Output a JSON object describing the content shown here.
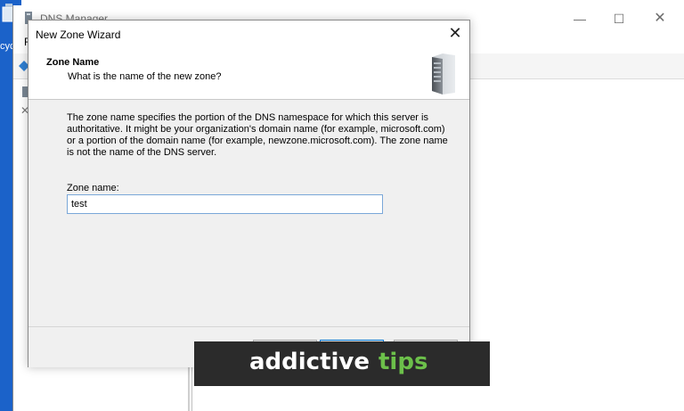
{
  "desktop": {
    "recycle_label": "cyc"
  },
  "dns_window": {
    "title": "DNS Manager",
    "menu_first_letter": "F",
    "controls": {
      "minimize": "—",
      "maximize": "☐",
      "close": "✕"
    }
  },
  "wizard": {
    "title": "New Zone Wizard",
    "close": "✕",
    "heading": "Zone Name",
    "subheading": "What is the name of the new zone?",
    "description": "The zone name specifies the portion of the DNS namespace for which this server is authoritative. It might be your organization's domain name (for example, microsoft.com) or a portion of the domain name (for example, newzone.microsoft.com). The zone name is not the name of the DNS server.",
    "zone_name_label": "Zone name:",
    "zone_name_value": "test",
    "buttons": {
      "back": "",
      "next": "",
      "cancel": ""
    }
  },
  "watermark": {
    "part1": "addictive",
    "part2": "tips",
    "part2_color": "#6cc04a"
  },
  "icons": {
    "server": "server-icon",
    "app": "dns-manager-icon",
    "close": "close-icon"
  }
}
